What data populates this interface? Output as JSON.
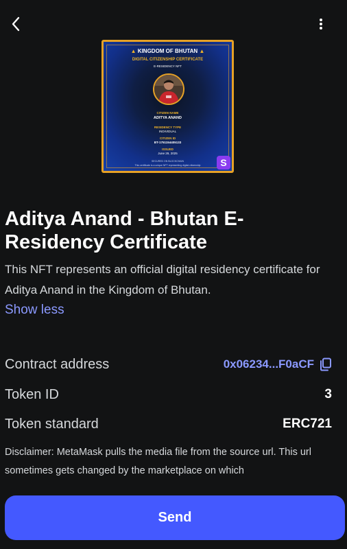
{
  "nft": {
    "name": "Aditya Anand - Bhutan E-Residency Certificate",
    "description": "This NFT represents an official digital residency certificate for Aditya Anand in the Kingdom of Bhutan.",
    "show_less_label": "Show less"
  },
  "certificate": {
    "title": "KINGDOM OF BHUTAN",
    "subtitle": "DIGITAL CITIZENSHIP CERTIFICATE",
    "kind": "E-RESIDENCY NFT",
    "name_label": "CITIZEN NAME",
    "name_value": "ADITYA ANAND",
    "type_label": "RESIDENCY TYPE",
    "type_value": "INDIVIDUAL",
    "id_label": "CITIZEN ID",
    "id_value": "BT-1751154405133",
    "issued_label": "ISSUED",
    "issued_value": "June 29, 2025",
    "footer_line1": "SECURED ON BLOCKCHAIN",
    "footer_line2": "This certificate is a unique NFT representing digital citizenship",
    "badge": "S"
  },
  "details": {
    "contract_label": "Contract address",
    "contract_value": "0x06234...F0aCF",
    "token_id_label": "Token ID",
    "token_id_value": "3",
    "standard_label": "Token standard",
    "standard_value": "ERC721"
  },
  "disclaimer": "Disclaimer: MetaMask pulls the media file from the source url. This url sometimes gets changed by the marketplace on which",
  "actions": {
    "send_label": "Send"
  },
  "icons": {
    "back": "chevron-left-icon",
    "menu": "more-vertical-icon",
    "copy": "copy-icon"
  },
  "colors": {
    "background": "#121314",
    "accent": "#8b99ff",
    "primary_button": "#4459ff",
    "certificate_border": "#e6a126"
  }
}
